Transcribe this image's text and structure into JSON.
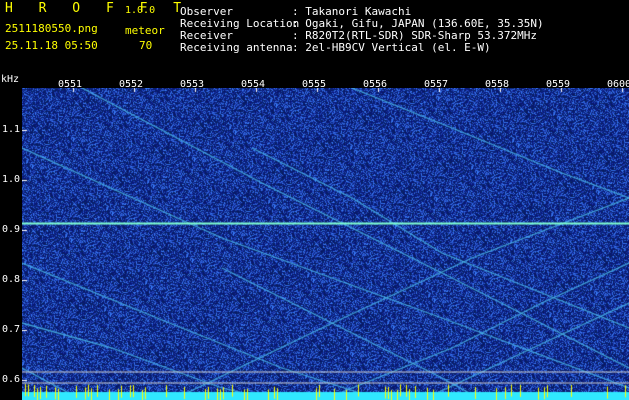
{
  "header": {
    "app_name": "H R O F F T",
    "version": "1.0.0",
    "filename": "2511180550.png",
    "timestamp": "25.11.18 05:50",
    "count_label": "meteor",
    "count_value": "70",
    "fields": [
      {
        "label": "Observer",
        "value": ": Takanori Kawachi"
      },
      {
        "label": "Receiving Location",
        "value": ": Ogaki, Gifu, JAPAN (136.60E, 35.35N)"
      },
      {
        "label": "Receiver",
        "value": ": R820T2(RTL-SDR) SDR-Sharp 53.372MHz"
      },
      {
        "label": "Receiving antenna",
        "value": ": 2el-HB9CV Vertical (el. E-W)"
      }
    ]
  },
  "spectrogram": {
    "y_unit": "kHz",
    "x_ticks": [
      "0551",
      "0552",
      "0553",
      "0554",
      "0555",
      "0556",
      "0557",
      "0558",
      "0559",
      "0600"
    ],
    "y_ticks": [
      "1.1",
      "1.0",
      "0.9",
      "0.8",
      "0.7",
      "0.6"
    ],
    "y_tick_values": [
      1.1,
      1.0,
      0.9,
      0.8,
      0.7,
      0.6
    ],
    "colors": {
      "background": "#0a1470",
      "noise": "#2a48d0",
      "trace": "#4ab8e8",
      "carrier": "#80ffd0",
      "baseline": "#30e8ff",
      "spike": "#ffff00"
    }
  }
}
